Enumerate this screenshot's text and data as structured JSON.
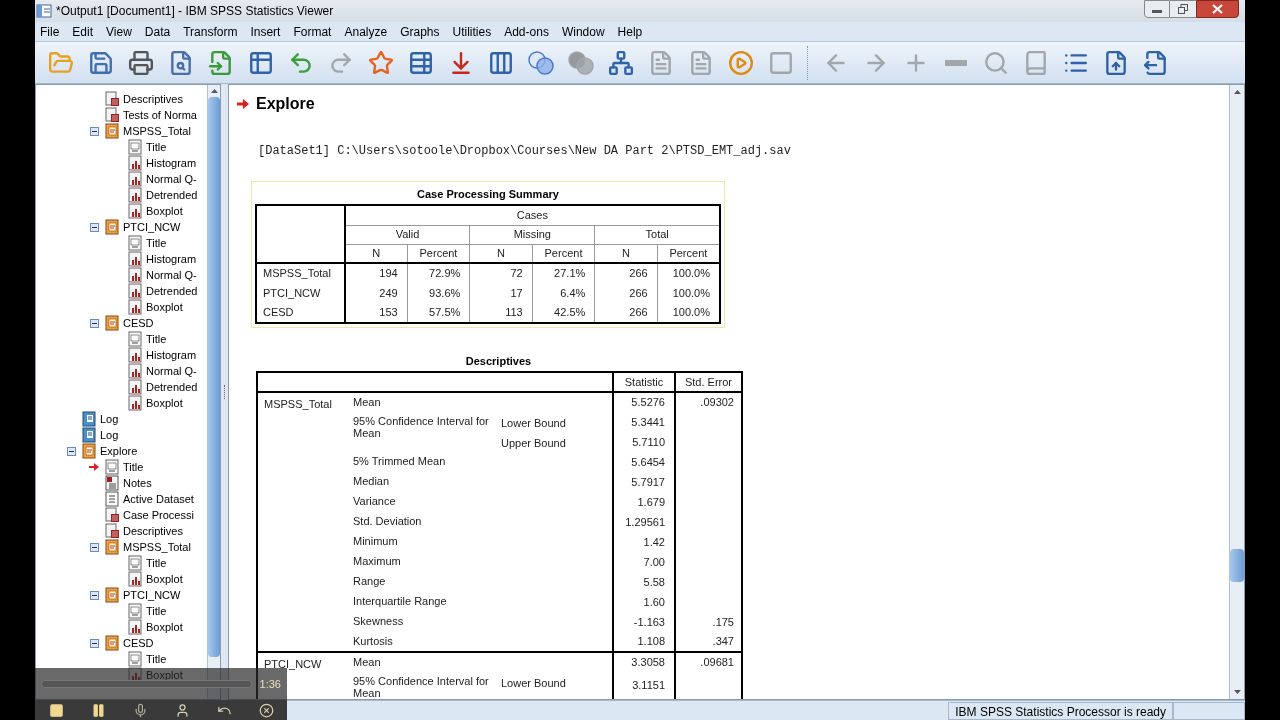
{
  "window": {
    "title": "*Output1 [Document1] - IBM SPSS Statistics Viewer"
  },
  "menu": [
    "File",
    "Edit",
    "View",
    "Data",
    "Transform",
    "Insert",
    "Format",
    "Analyze",
    "Graphs",
    "Utilities",
    "Add-ons",
    "Window",
    "Help"
  ],
  "toolbar_groups": [
    [
      {
        "kind": "open",
        "disabled": false
      },
      {
        "kind": "save",
        "disabled": false
      },
      {
        "kind": "print",
        "disabled": false
      },
      {
        "kind": "preview",
        "disabled": false
      },
      {
        "kind": "recall",
        "disabled": false
      },
      {
        "kind": "data",
        "disabled": false
      },
      {
        "kind": "undo",
        "disabled": false
      },
      {
        "kind": "redo",
        "disabled": true
      },
      {
        "kind": "case",
        "disabled": false
      },
      {
        "kind": "variable",
        "disabled": false
      },
      {
        "kind": "insert",
        "disabled": false
      },
      {
        "kind": "variables",
        "disabled": false
      },
      {
        "kind": "sets",
        "disabled": false
      },
      {
        "kind": "sets",
        "disabled": true
      },
      {
        "kind": "outline",
        "disabled": false
      },
      {
        "kind": "page",
        "disabled": true
      },
      {
        "kind": "page",
        "disabled": true
      },
      {
        "kind": "run",
        "disabled": false
      },
      {
        "kind": "frame",
        "disabled": true
      }
    ],
    [
      {
        "kind": "back",
        "disabled": true
      },
      {
        "kind": "forward",
        "disabled": true
      },
      {
        "kind": "expand",
        "disabled": true
      },
      {
        "kind": "collapse",
        "disabled": true
      },
      {
        "kind": "show",
        "disabled": true
      },
      {
        "kind": "hide",
        "disabled": true
      },
      {
        "kind": "heading",
        "disabled": false
      },
      {
        "kind": "promote",
        "disabled": false
      },
      {
        "kind": "demote",
        "disabled": false
      }
    ]
  ],
  "tree": [
    {
      "children": [
        {
          "label": "Descriptives",
          "kind": "table",
          "current": false
        },
        {
          "label": "Tests of Norma",
          "kind": "table",
          "current": false
        },
        {
          "label": "MSPSS_Total",
          "kind": "group",
          "current": false,
          "expanded": true,
          "children": [
            {
              "label": "Title",
              "kind": "title",
              "current": false
            },
            {
              "label": "Histogram",
              "kind": "chart",
              "current": false
            },
            {
              "label": "Normal Q-",
              "kind": "chart",
              "current": false
            },
            {
              "label": "Detrended",
              "kind": "chart",
              "current": false
            },
            {
              "label": "Boxplot",
              "kind": "chart",
              "current": false
            }
          ]
        },
        {
          "label": "PTCI_NCW",
          "kind": "group",
          "current": false,
          "expanded": true,
          "children": [
            {
              "label": "Title",
              "kind": "title",
              "current": false
            },
            {
              "label": "Histogram",
              "kind": "chart",
              "current": false
            },
            {
              "label": "Normal Q-",
              "kind": "chart",
              "current": false
            },
            {
              "label": "Detrended",
              "kind": "chart",
              "current": false
            },
            {
              "label": "Boxplot",
              "kind": "chart",
              "current": false
            }
          ]
        },
        {
          "label": "CESD",
          "kind": "group",
          "current": false,
          "expanded": true,
          "children": [
            {
              "label": "Title",
              "kind": "title",
              "current": false
            },
            {
              "label": "Histogram",
              "kind": "chart",
              "current": false
            },
            {
              "label": "Normal Q-",
              "kind": "chart",
              "current": false
            },
            {
              "label": "Detrended",
              "kind": "chart",
              "current": false
            },
            {
              "label": "Boxplot",
              "kind": "chart",
              "current": false
            }
          ]
        }
      ]
    },
    {
      "label": "Log",
      "kind": "log",
      "current": false
    },
    {
      "label": "Log",
      "kind": "log",
      "current": false
    },
    {
      "label": "Explore",
      "kind": "group",
      "current": false,
      "expanded": true,
      "children": [
        {
          "label": "Title",
          "kind": "title",
          "current": true
        },
        {
          "label": "Notes",
          "kind": "notes",
          "current": false
        },
        {
          "label": "Active Dataset",
          "kind": "dataset",
          "current": false
        },
        {
          "label": "Case Processi",
          "kind": "table",
          "current": false
        },
        {
          "label": "Descriptives",
          "kind": "table",
          "current": false
        },
        {
          "label": "MSPSS_Total",
          "kind": "group",
          "current": false,
          "expanded": true,
          "children": [
            {
              "label": "Title",
              "kind": "title",
              "current": false
            },
            {
              "label": "Boxplot",
              "kind": "chart",
              "current": false
            }
          ]
        },
        {
          "label": "PTCI_NCW",
          "kind": "group",
          "current": false,
          "expanded": true,
          "children": [
            {
              "label": "Title",
              "kind": "title",
              "current": false
            },
            {
              "label": "Boxplot",
              "kind": "chart",
              "current": false
            }
          ]
        },
        {
          "label": "CESD",
          "kind": "group",
          "current": false,
          "expanded": true,
          "children": [
            {
              "label": "Title",
              "kind": "title",
              "current": false
            },
            {
              "label": "Boxplot",
              "kind": "chart",
              "current": false
            }
          ]
        }
      ]
    }
  ],
  "output": {
    "heading": "Explore",
    "dataset_line": "[DataSet1] C:\\Users\\sotoole\\Dropbox\\Courses\\New DA Part 2\\PTSD_EMT_adj.sav",
    "case_summary": {
      "title": "Case Processing Summary",
      "header": "Cases",
      "groups": [
        "Valid",
        "Missing",
        "Total"
      ],
      "subheaders": [
        "N",
        "Percent",
        "N",
        "Percent",
        "N",
        "Percent"
      ],
      "rows": [
        {
          "label": "MSPSS_Total",
          "values": [
            "194",
            "72.9%",
            "72",
            "27.1%",
            "266",
            "100.0%"
          ]
        },
        {
          "label": "PTCI_NCW",
          "values": [
            "249",
            "93.6%",
            "17",
            "6.4%",
            "266",
            "100.0%"
          ]
        },
        {
          "label": "CESD",
          "values": [
            "153",
            "57.5%",
            "113",
            "42.5%",
            "266",
            "100.0%"
          ]
        }
      ]
    },
    "descriptives": {
      "title": "Descriptives",
      "columns": [
        "Statistic",
        "Std. Error"
      ],
      "groups": [
        {
          "name": "MSPSS_Total",
          "rows": [
            {
              "label": "Mean",
              "statistic": "5.5276",
              "std_error": ".09302"
            },
            {
              "label": "95% Confidence Interval for Mean",
              "bounds": [
                {
                  "sublabel": "Lower Bound",
                  "statistic": "5.3441"
                },
                {
                  "sublabel": "Upper Bound",
                  "statistic": "5.7110"
                }
              ]
            },
            {
              "label": "5% Trimmed Mean",
              "statistic": "5.6454"
            },
            {
              "label": "Median",
              "statistic": "5.7917"
            },
            {
              "label": "Variance",
              "statistic": "1.679"
            },
            {
              "label": "Std. Deviation",
              "statistic": "1.29561"
            },
            {
              "label": "Minimum",
              "statistic": "1.42"
            },
            {
              "label": "Maximum",
              "statistic": "7.00"
            },
            {
              "label": "Range",
              "statistic": "5.58"
            },
            {
              "label": "Interquartile Range",
              "statistic": "1.60"
            },
            {
              "label": "Skewness",
              "statistic": "-1.163",
              "std_error": ".175"
            },
            {
              "label": "Kurtosis",
              "statistic": "1.108",
              "std_error": ".347"
            }
          ]
        },
        {
          "name": "PTCI_NCW",
          "rows": [
            {
              "label": "Mean",
              "statistic": "3.3058",
              "std_error": ".09681"
            },
            {
              "label": "95% Confidence Interval for Mean",
              "bounds": [
                {
                  "sublabel": "Lower Bound",
                  "statistic": "3.1151"
                }
              ]
            }
          ]
        }
      ]
    }
  },
  "status_bar": {
    "message": "IBM SPSS Statistics Processor is ready"
  },
  "recorder": {
    "time": "1:36",
    "buttons": [
      {
        "kind": "stop"
      },
      {
        "kind": "pause"
      },
      {
        "kind": "mic"
      },
      {
        "kind": "webcam"
      },
      {
        "kind": "undo"
      },
      {
        "kind": "close"
      }
    ]
  }
}
